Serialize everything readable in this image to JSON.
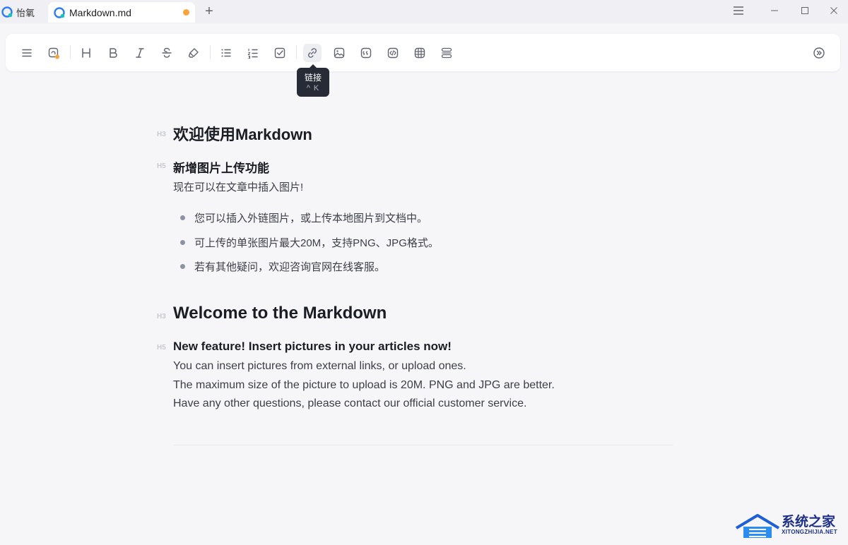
{
  "titlebar": {
    "app_name": "怡氧",
    "tab_title": "Markdown.md",
    "new_tab_symbol": "+"
  },
  "toolbar": {
    "buttons": [
      {
        "name": "menu",
        "icon": "hamburger-icon"
      },
      {
        "name": "save-status",
        "icon": "save-status-icon"
      },
      {
        "name": "heading",
        "icon": "heading-icon"
      },
      {
        "name": "bold",
        "icon": "bold-icon"
      },
      {
        "name": "italic",
        "icon": "italic-icon"
      },
      {
        "name": "strikethrough",
        "icon": "strikethrough-icon"
      },
      {
        "name": "highlight",
        "icon": "highlighter-icon"
      },
      {
        "name": "bullet-list",
        "icon": "bullet-list-icon"
      },
      {
        "name": "numbered-list",
        "icon": "numbered-list-icon"
      },
      {
        "name": "task-list",
        "icon": "checkbox-icon"
      },
      {
        "name": "link",
        "icon": "link-icon"
      },
      {
        "name": "image",
        "icon": "image-icon"
      },
      {
        "name": "quote",
        "icon": "quote-icon"
      },
      {
        "name": "code",
        "icon": "code-icon"
      },
      {
        "name": "table",
        "icon": "table-icon"
      },
      {
        "name": "divider",
        "icon": "divider-icon"
      },
      {
        "name": "more",
        "icon": "chevron-right-circle-icon"
      }
    ],
    "tooltip": {
      "title": "链接",
      "shortcut": "^ K"
    },
    "status_dot_color": "#f9a33a"
  },
  "content": {
    "heading_cn": {
      "level": "H3",
      "text": "欢迎使用Markdown"
    },
    "subheading_cn": {
      "level": "H5",
      "text": "新增图片上传功能"
    },
    "para_cn": "现在可以在文章中插入图片!",
    "bullets_cn": [
      "您可以插入外链图片，或上传本地图片到文档中。",
      "可上传的单张图片最大20M，支持PNG、JPG格式。",
      "若有其他疑问，欢迎咨询官网在线客服。"
    ],
    "heading_en": {
      "level": "H3",
      "text": "Welcome to the Markdown"
    },
    "subheading_en": {
      "level": "H5",
      "text": "New feature! Insert pictures in your articles now!"
    },
    "paras_en": [
      "You can insert pictures from external links, or upload ones.",
      "The maximum size of the picture to upload is 20M. PNG and JPG are better.",
      "Have any other questions, please contact our official customer service."
    ]
  },
  "watermark": {
    "main": "系统之家",
    "sub": "XITONGZHIJIA.NET",
    "color": "#1d2f86"
  }
}
